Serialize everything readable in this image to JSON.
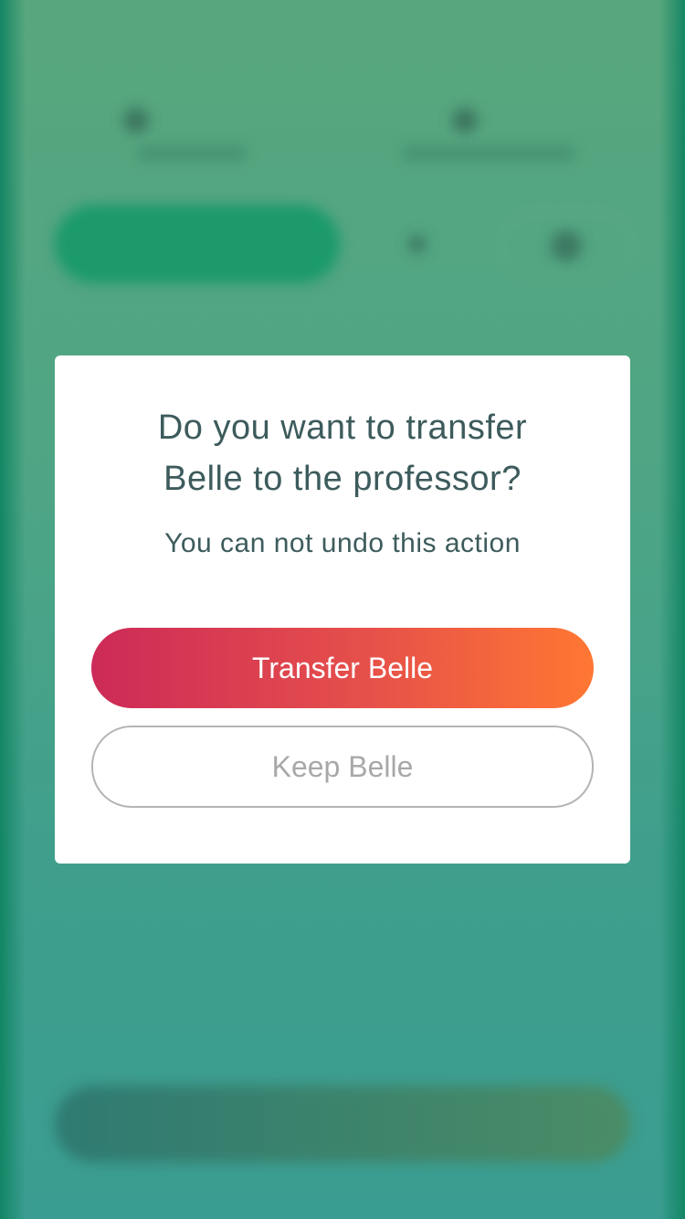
{
  "dialog": {
    "title_line1": "Do you want to transfer",
    "title_line2": "Belle to the professor?",
    "subtitle": "You can not undo this action",
    "confirm_label": "Transfer Belle",
    "cancel_label": "Keep Belle"
  },
  "colors": {
    "confirm_gradient_start": "#cc2a58",
    "confirm_gradient_end": "#ff7732",
    "title_text": "#3d5b5c",
    "cancel_border": "#b4b4b4",
    "cancel_text": "#a8a8a8",
    "background_green": "#4ea585"
  }
}
